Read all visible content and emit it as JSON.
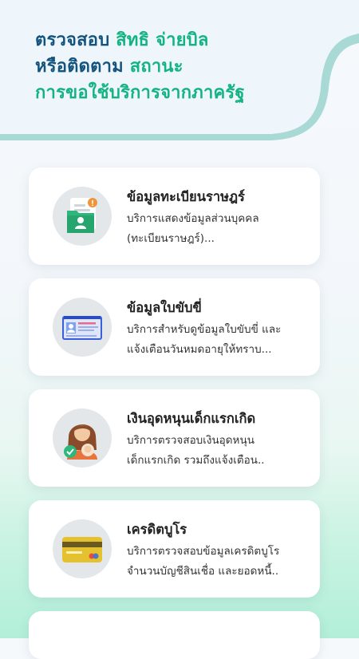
{
  "header": {
    "line1_a": "ตรวจสอบ ",
    "line1_b": "สิทธิ จ่ายบิล",
    "line2_a": "หรือติดตาม ",
    "line2_b": "สถานะ",
    "line3": "การขอใช้บริการจากภาครัฐ"
  },
  "colors": {
    "title_dark": "#13547e",
    "title_green": "#13b382",
    "header_band": "#a9d9d4"
  },
  "cards": [
    {
      "icon": "house-registration-icon",
      "title": "ข้อมูลทะเบียนราษฎร์",
      "desc1": "บริการแสดงข้อมูลส่วนบุคคล",
      "desc2": "(ทะเบียนราษฎร์)..."
    },
    {
      "icon": "driver-license-icon",
      "title": "ข้อมูลใบขับขี่",
      "desc1": "บริการสำหรับดูข้อมูลใบขับขี่ และ",
      "desc2": "แจ้งเตือนวันหมดอายุให้ทราบ..."
    },
    {
      "icon": "mother-child-icon",
      "title": "เงินอุดหนุนเด็กแรกเกิด",
      "desc1": "บริการตรวจสอบเงินอุดหนุน",
      "desc2": "เด็กแรกเกิด รวมถึงแจ้งเตือน.."
    },
    {
      "icon": "credit-card-icon",
      "title": "เครดิตบูโร",
      "desc1": "บริการตรวจสอบข้อมูลเครดิตบูโร",
      "desc2": "จำนวนบัญชีสินเชื่อ และยอดหนี้.."
    }
  ]
}
